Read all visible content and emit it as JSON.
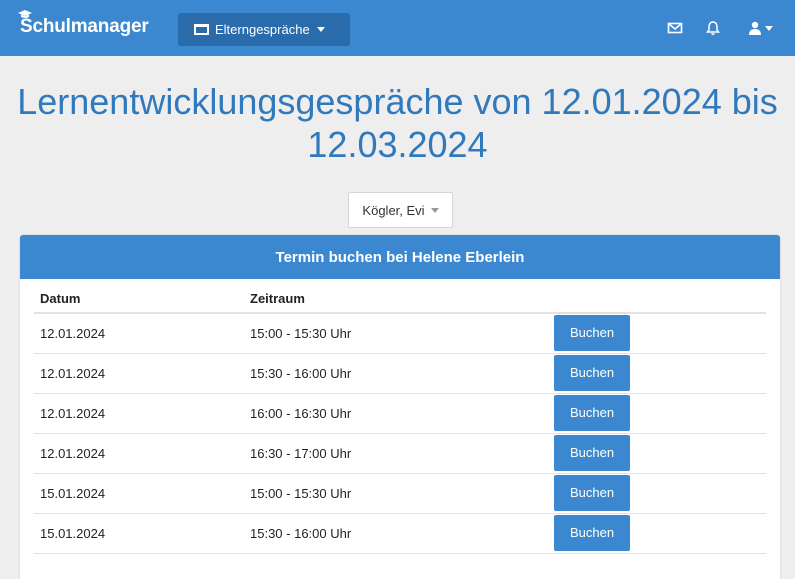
{
  "app": {
    "brand": "Schulmanager",
    "module_label": "Elterngespräche",
    "icons": [
      "graduation-cap-icon",
      "window-icon",
      "mail-icon",
      "bell-icon",
      "user-icon"
    ],
    "accent_color": "#3b88d1"
  },
  "page": {
    "title": "Lernentwicklungsgespräche von 12.01.2024 bis 12.03.2024",
    "person_select": "Kögler, Evi"
  },
  "panel": {
    "heading": "Termin buchen bei Helene Eberlein",
    "columns": [
      "Datum",
      "Zeitraum"
    ],
    "rows": [
      {
        "date": "12.01.2024",
        "time": "15:00 - 15:30 Uhr",
        "action": "Buchen"
      },
      {
        "date": "12.01.2024",
        "time": "15:30 - 16:00 Uhr",
        "action": "Buchen"
      },
      {
        "date": "12.01.2024",
        "time": "16:00 - 16:30 Uhr",
        "action": "Buchen"
      },
      {
        "date": "12.01.2024",
        "time": "16:30 - 17:00 Uhr",
        "action": "Buchen"
      },
      {
        "date": "15.01.2024",
        "time": "15:00 - 15:30 Uhr",
        "action": "Buchen"
      },
      {
        "date": "15.01.2024",
        "time": "15:30 - 16:00 Uhr",
        "action": "Buchen"
      }
    ]
  }
}
